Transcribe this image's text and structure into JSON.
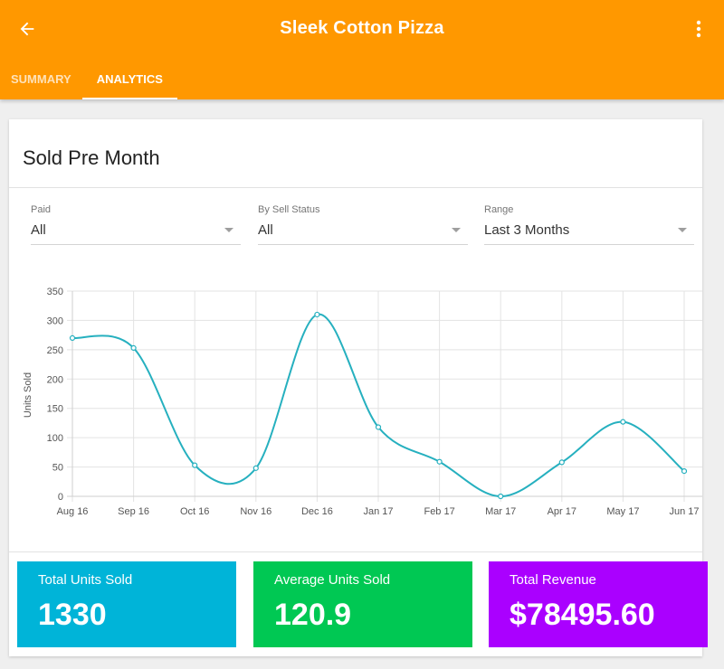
{
  "header": {
    "title": "Sleek Cotton Pizza",
    "back_icon": "arrow-left-icon",
    "menu_icon": "more-vert-icon",
    "background": "#ff9800"
  },
  "tabs": [
    {
      "label": "SUMMARY",
      "active": false
    },
    {
      "label": "ANALYTICS",
      "active": true
    }
  ],
  "card": {
    "title": "Sold Pre Month"
  },
  "filters": [
    {
      "label": "Paid",
      "value": "All"
    },
    {
      "label": "By Sell Status",
      "value": "All"
    },
    {
      "label": "Range",
      "value": "Last 3 Months"
    }
  ],
  "chart_data": {
    "type": "line",
    "title": "",
    "xlabel": "",
    "ylabel": "Units Sold",
    "ylim": [
      0,
      350
    ],
    "yticks": [
      0,
      50,
      100,
      150,
      200,
      250,
      300,
      350
    ],
    "categories": [
      "Aug 16",
      "Sep 16",
      "Oct 16",
      "Nov 16",
      "Dec 16",
      "Jan 17",
      "Feb 17",
      "Mar 17",
      "Apr 17",
      "May 17",
      "Jun 17"
    ],
    "series": [
      {
        "values": [
          270,
          253,
          53,
          48,
          310,
          118,
          59,
          0,
          58,
          127,
          43
        ],
        "color": "#26b0bf"
      }
    ],
    "grid": true
  },
  "stats": [
    {
      "label": "Total Units Sold",
      "value": "1330",
      "color": "#00b4d8"
    },
    {
      "label": "Average Units Sold",
      "value": "120.9",
      "color": "#00c853"
    },
    {
      "label": "Total Revenue",
      "value": "$78495.60",
      "color": "#aa00ff"
    }
  ]
}
